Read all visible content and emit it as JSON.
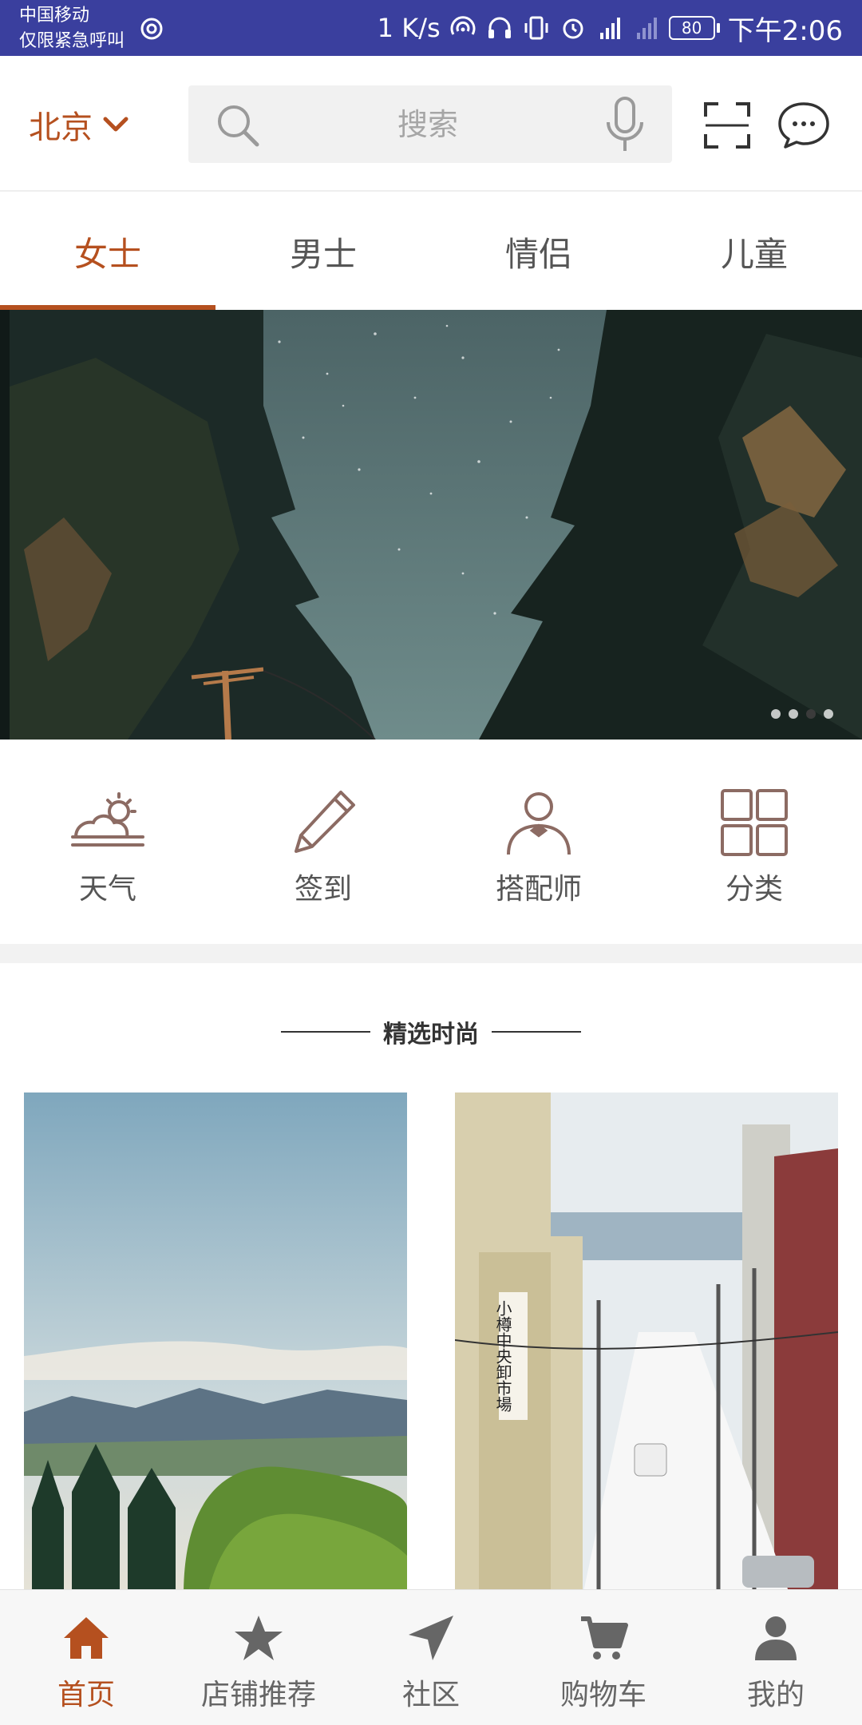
{
  "status_bar": {
    "carrier": "中国移动",
    "emergency": "仅限紧急呼叫",
    "speed": "1 K/s",
    "battery": "80",
    "time": "下午2:06"
  },
  "header": {
    "city": "北京",
    "search_placeholder": "搜索"
  },
  "tabs": [
    {
      "label": "女士",
      "active": true
    },
    {
      "label": "男士",
      "active": false
    },
    {
      "label": "情侣",
      "active": false
    },
    {
      "label": "儿童",
      "active": false
    }
  ],
  "banner": {
    "page_count": 4,
    "active_page": 3
  },
  "quick_entries": [
    {
      "label": "天气",
      "icon": "weather-icon"
    },
    {
      "label": "签到",
      "icon": "pencil-icon"
    },
    {
      "label": "搭配师",
      "icon": "stylist-icon"
    },
    {
      "label": "分类",
      "icon": "category-icon"
    }
  ],
  "section": {
    "title": "精选时尚"
  },
  "cards": [
    {
      "name": "mountain-forest-card"
    },
    {
      "name": "snowy-street-card",
      "sign_text": "小樽中央卸市場"
    }
  ],
  "bottom_nav": [
    {
      "label": "首页",
      "icon": "home-icon",
      "active": true
    },
    {
      "label": "店铺推荐",
      "icon": "star-icon",
      "active": false
    },
    {
      "label": "社区",
      "icon": "navigation-arrow-icon",
      "active": false
    },
    {
      "label": "购物车",
      "icon": "cart-icon",
      "active": false
    },
    {
      "label": "我的",
      "icon": "person-icon",
      "active": false
    }
  ],
  "colors": {
    "accent": "#b5501f",
    "status_bar": "#3a3f9e",
    "icon_brown": "#8c6b63"
  }
}
